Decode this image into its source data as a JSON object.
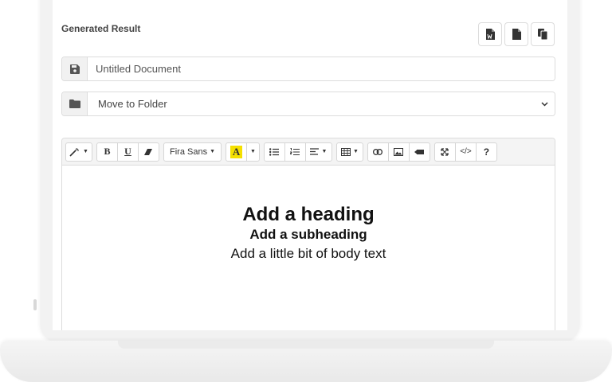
{
  "result_title": "Generated Result",
  "actions": [
    {
      "name": "download-word-button",
      "icon": "word-file-icon"
    },
    {
      "name": "download-file-button",
      "icon": "file-icon"
    },
    {
      "name": "copy-button",
      "icon": "copy-icon"
    }
  ],
  "document": {
    "title_placeholder": "Untitled Document",
    "icon": "save-icon"
  },
  "folder": {
    "selected": "Move to Folder",
    "icon": "folder-icon"
  },
  "toolbar": {
    "font_name": "Fira Sans",
    "bold": "B",
    "underline": "U",
    "highlight": "A",
    "help": "?",
    "code": "</>"
  },
  "content": {
    "heading": "Add a heading",
    "subheading": "Add a subheading",
    "body": "Add a little bit of body text"
  },
  "colors": {
    "highlight": "#f5e000"
  }
}
